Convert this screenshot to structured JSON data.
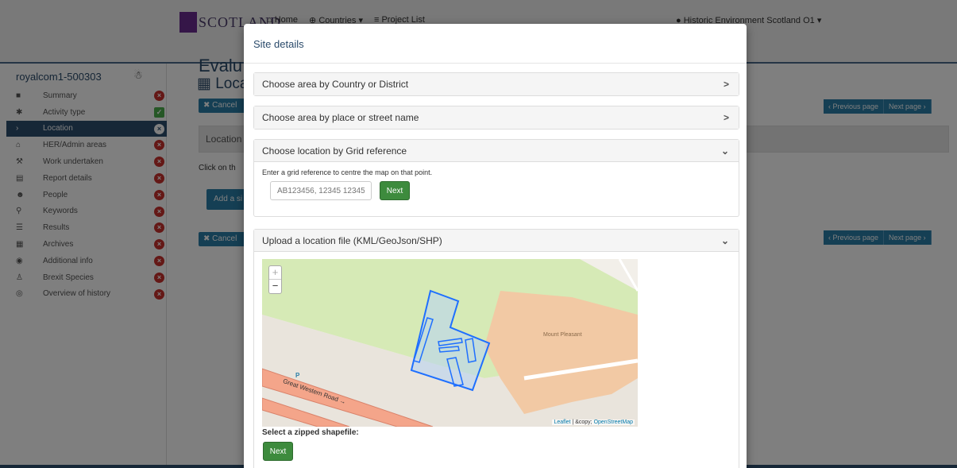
{
  "header": {
    "brand": "SCOTLAND",
    "nav": [
      "Home",
      "Countries",
      "Project List"
    ],
    "user": "Historic Environment Scotland O1"
  },
  "sidebar": {
    "title": "royalcom1-500303",
    "items": [
      {
        "label": "Summary",
        "status": "x"
      },
      {
        "label": "Activity type",
        "status": "ok"
      },
      {
        "label": "Location",
        "status": "x",
        "active": true
      },
      {
        "label": "HER/Admin areas",
        "status": "x"
      },
      {
        "label": "Work undertaken",
        "status": "x"
      },
      {
        "label": "Report details",
        "status": "x"
      },
      {
        "label": "People",
        "status": "x"
      },
      {
        "label": "Keywords",
        "status": "x"
      },
      {
        "label": "Results",
        "status": "x"
      },
      {
        "label": "Archives",
        "status": "x"
      },
      {
        "label": "Additional info",
        "status": "x"
      },
      {
        "label": "Brexit Species",
        "status": "x"
      },
      {
        "label": "Overview of history",
        "status": "x"
      }
    ]
  },
  "main": {
    "heading": "Evalu",
    "subheading": "Loca",
    "cancel": "Cancel",
    "location_panel": "Location",
    "click_text": "Click on th",
    "add_button": "Add a si",
    "pager": {
      "previous": "‹ Previous page",
      "next": "Next page ›"
    }
  },
  "modal": {
    "title": "Site details",
    "sections": [
      {
        "title": "Choose area by Country or District",
        "chevron": ">"
      },
      {
        "title": "Choose area by place or street name",
        "chevron": ">"
      },
      {
        "title": "Choose location by Grid reference",
        "chevron": "⌄"
      },
      {
        "title": "Upload a location file (KML/GeoJson/SHP)",
        "chevron": "⌄"
      }
    ],
    "grid_help": "Enter a grid reference to centre the map on that point.",
    "grid_placeholder": "AB123456, 12345 12345",
    "next_label": "Next",
    "map": {
      "zoom_in": "+",
      "zoom_out": "−",
      "poi_label": "Mount Pleasant",
      "road_label": "Great Western Road →",
      "parking": "P",
      "attribution_leaflet": "Leaflet",
      "attribution_sep": " | &copy; ",
      "attribution_osm": "OpenStreetMap"
    },
    "shapefile_label": "Select a zipped shapefile:",
    "shapefile_next": "Next"
  },
  "colors": {
    "modal_title": "#2a4a6a",
    "next_green": "#3d8b3d",
    "polygon_blue": "#1e6fff",
    "sidebar_active": "#2d4f6f",
    "residential": "#f2c9a4",
    "park": "#d6eab6"
  }
}
